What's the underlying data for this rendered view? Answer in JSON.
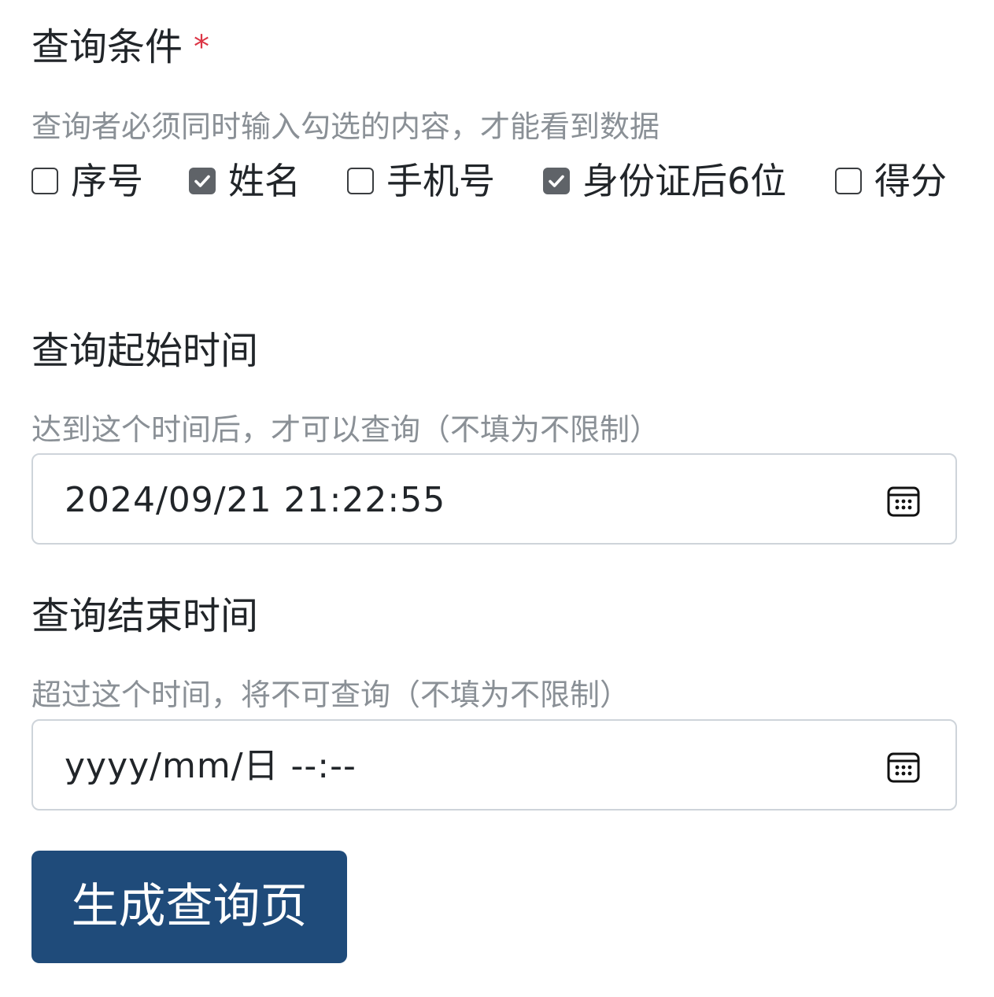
{
  "conditions": {
    "label": "查询条件",
    "required_mark": "*",
    "hint": "查询者必须同时输入勾选的内容，才能看到数据",
    "options": [
      {
        "label": "序号",
        "checked": false
      },
      {
        "label": "姓名",
        "checked": true
      },
      {
        "label": "手机号",
        "checked": false
      },
      {
        "label": "身份证后6位",
        "checked": true
      },
      {
        "label": "得分",
        "checked": false
      }
    ]
  },
  "start_time": {
    "label": "查询起始时间",
    "hint": "达到这个时间后，才可以查询（不填为不限制）",
    "value": "2024/09/21  21:22:55"
  },
  "end_time": {
    "label": "查询结束时间",
    "hint": "超过这个时间，将不可查询（不填为不限制）",
    "placeholder": "yyyy/mm/日  --:--"
  },
  "submit": {
    "label": "生成查询页"
  }
}
